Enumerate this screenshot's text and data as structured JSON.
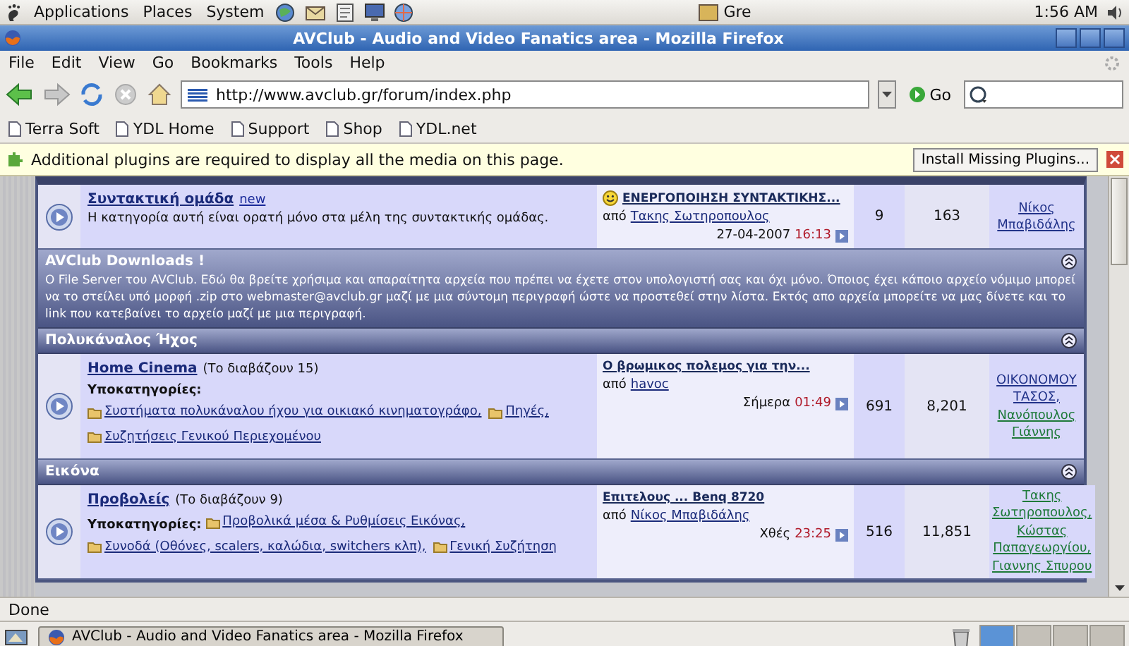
{
  "top_panel": {
    "menus": [
      "Applications",
      "Places",
      "System"
    ],
    "window_button": "Gre",
    "clock": "1:56 AM"
  },
  "window": {
    "title": "AVClub - Audio and Video Fanatics area - Mozilla Firefox"
  },
  "menu_bar": [
    "File",
    "Edit",
    "View",
    "Go",
    "Bookmarks",
    "Tools",
    "Help"
  ],
  "toolbar": {
    "url": "http://www.avclub.gr/forum/index.php",
    "go": "Go"
  },
  "bookmarks": [
    "Terra Soft",
    "YDL Home",
    "Support",
    "Shop",
    "YDL.net"
  ],
  "plugin_bar": {
    "message": "Additional plugins are required to display all the media on this page.",
    "button": "Install Missing Plugins..."
  },
  "forum": [
    {
      "kind": "forum",
      "title": "Συντακτική ομάδα",
      "badge": "new",
      "description": "Η κατηγορία αυτή είναι ορατή μόνο στα μέλη της συντακτικής ομάδας.",
      "last_post": {
        "smiley": true,
        "title": "ΕΝΕΡΓΟΠΟΙΗΣΗ ΣΥΝΤΑΚΤΙΚΗΣ...",
        "by_label": "από",
        "author": "Τακης Σωτηροπουλος",
        "when": "27-04-2007",
        "time": "16:13"
      },
      "topics": "9",
      "posts": "163",
      "moderators": [
        {
          "name": "Νίκος Μπαβιδάλης",
          "color": "#22338a"
        }
      ]
    },
    {
      "kind": "category",
      "title": "AVClub Downloads !",
      "description": "Ο File Server του AVClub. Εδώ θα βρείτε χρήσιμα και απαραίτητα αρχεία που πρέπει να έχετε στον υπολογιστή σας και όχι μόνο. Όποιος έχει κάποιο αρχείο νόμιμο μπορεί να το στείλει υπό μορφή .zip στο webmaster@avclub.gr μαζί με μια σύντομη περιγραφή ώστε να προστεθεί στην λίστα. Εκτός απο αρχεία μπορείτε να μας δίνετε και το link που κατεβαίνει το αρχείο μαζί με μια περιγραφή."
    },
    {
      "kind": "category",
      "title": "Πολυκάναλος Ήχος"
    },
    {
      "kind": "forum",
      "title": "Home Cinema",
      "readers": "(Το διαβάζουν 15)",
      "sub_label": "Υποκατηγορίες:",
      "subforums": [
        "Συστήματα πολυκάναλου ήχου για οικιακό κινηματογράφο,",
        "Πηγές,",
        "Συζητήσεις Γενικού Περιεχομένου"
      ],
      "last_post": {
        "smiley": false,
        "title": "Ο βρωμικος πολεμος για την...",
        "by_label": "από",
        "author": "havoc",
        "when": "Σήμερα",
        "time": "01:49"
      },
      "topics": "691",
      "posts": "8,201",
      "moderators": [
        {
          "name": "ΟΙΚΟΝΟΜΟΥ ΤΑΣΟΣ,",
          "color": "#22338a"
        },
        {
          "name": "Νανόπουλος Γιάννης",
          "color": "#1e7a3a"
        }
      ]
    },
    {
      "kind": "category",
      "title": "Εικόνα"
    },
    {
      "kind": "forum",
      "title": "Προβολείς",
      "readers": "(Το διαβάζουν 9)",
      "sub_label": "Υποκατηγορίες:",
      "subforums": [
        "Προβολικά μέσα & Ρυθμίσεις Εικόνας,",
        "Συνοδά (Οθόνες, scalers, καλώδια, switchers κλπ),",
        "Γενική Συζήτηση"
      ],
      "last_post": {
        "smiley": false,
        "title": "Επιτελους ... Benq 8720",
        "by_label": "από",
        "author": "Νίκος Μπαβιδάλης",
        "when": "Χθές",
        "time": "23:25"
      },
      "topics": "516",
      "posts": "11,851",
      "moderators": [
        {
          "name": "Τακης Σωτηροπουλος,",
          "color": "#1e7a3a"
        },
        {
          "name": "Κώστας Παπαγεωργίου,",
          "color": "#1e7a3a"
        },
        {
          "name": "Γιαννης Σπυρου",
          "color": "#1e7a3a"
        }
      ]
    }
  ],
  "status_bar": "Done",
  "taskbar": {
    "task": "AVClub - Audio and Video Fanatics area - Mozilla Firefox",
    "workspaces": [
      {
        "selected": true
      },
      {
        "selected": false
      },
      {
        "selected": false
      },
      {
        "selected": false
      }
    ]
  }
}
